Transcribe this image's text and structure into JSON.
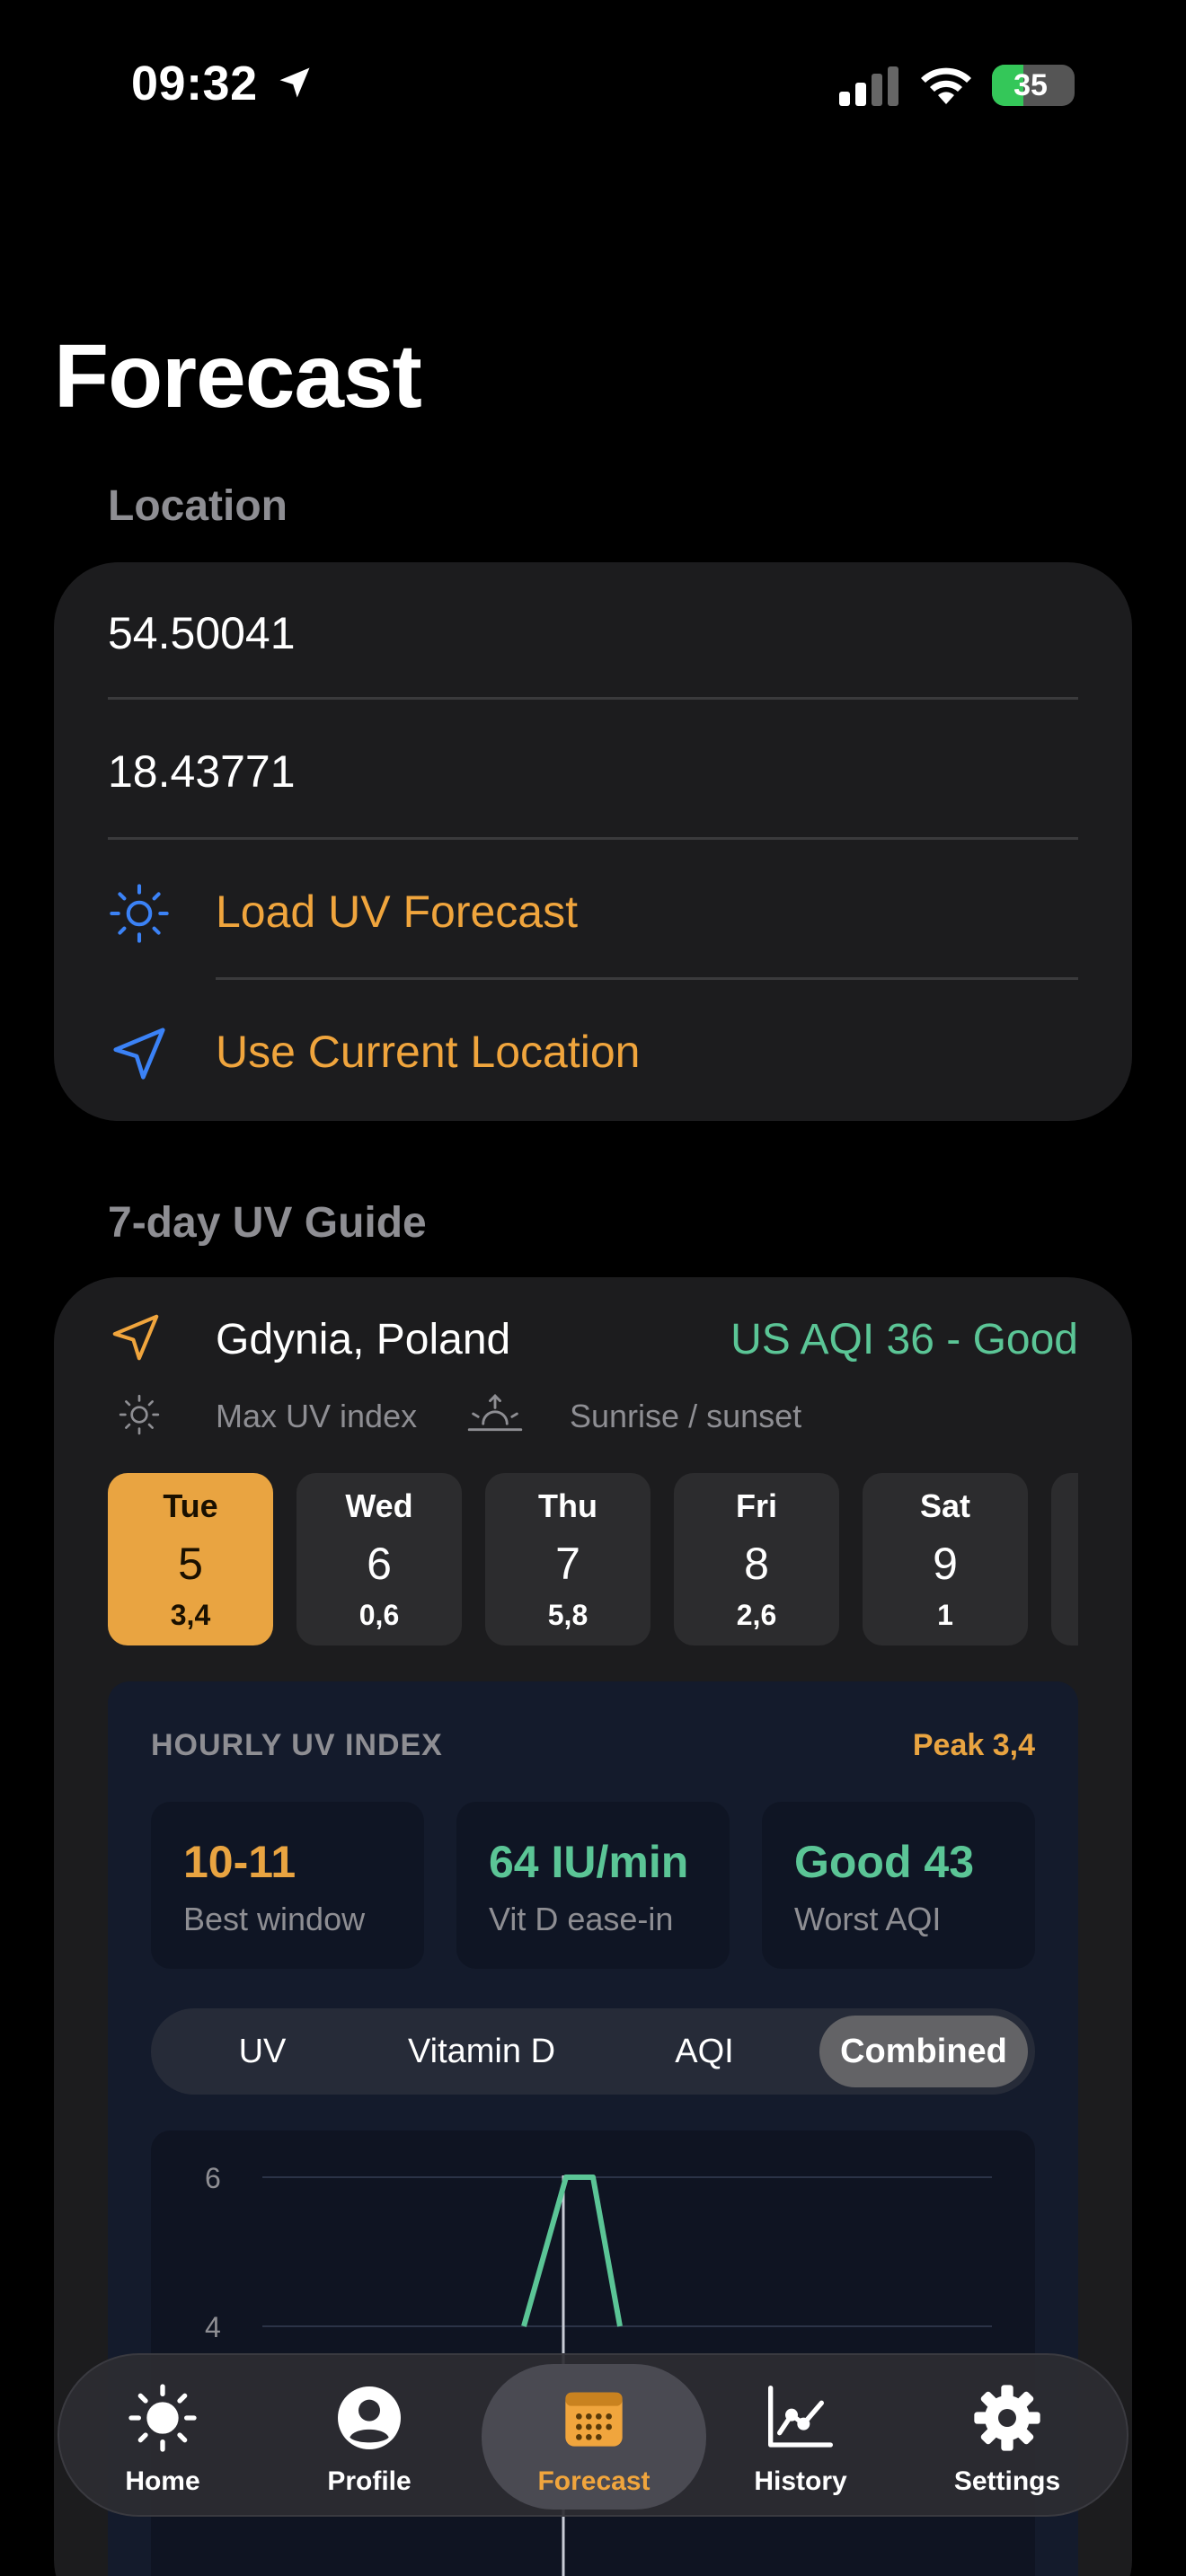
{
  "status_bar": {
    "time": "09:32",
    "battery": "35"
  },
  "title": "Forecast",
  "location_section": {
    "label": "Location",
    "latitude": "54.50041",
    "longitude": "18.43771",
    "load_action": "Load UV Forecast",
    "current_action": "Use Current Location"
  },
  "guide_section": {
    "label": "7-day UV Guide",
    "city": "Gdynia, Poland",
    "aqi": "US AQI 36 - Good",
    "legend_uv": "Max UV index",
    "legend_sun": "Sunrise / sunset",
    "days": [
      {
        "name": "Tue",
        "date": "5",
        "uv": "3,4",
        "selected": true
      },
      {
        "name": "Wed",
        "date": "6",
        "uv": "0,6"
      },
      {
        "name": "Thu",
        "date": "7",
        "uv": "5,8"
      },
      {
        "name": "Fri",
        "date": "8",
        "uv": "2,6"
      },
      {
        "name": "Sat",
        "date": "9",
        "uv": "1"
      }
    ]
  },
  "hourly": {
    "header": "HOURLY UV INDEX",
    "peak": "Peak 3,4",
    "stats": [
      {
        "value": "10-11",
        "label": "Best window",
        "color": "#e9a441"
      },
      {
        "value": "64 IU/min",
        "label": "Vit D ease-in",
        "color": "#5bc596"
      },
      {
        "value": "Good 43",
        "label": "Worst AQI",
        "color": "#5bc596"
      }
    ],
    "segments": [
      "UV",
      "Vitamin D",
      "AQI",
      "Combined"
    ],
    "active_segment": "Combined"
  },
  "chart_data": {
    "type": "line",
    "y_ticks": [
      "6",
      "4"
    ],
    "series": [
      {
        "values": [
          4,
          6,
          6,
          4
        ],
        "color": "#5bc596"
      }
    ]
  },
  "tabs": [
    {
      "label": "Home",
      "icon": "sun-icon"
    },
    {
      "label": "Profile",
      "icon": "person-icon"
    },
    {
      "label": "Forecast",
      "icon": "calendar-icon",
      "active": true
    },
    {
      "label": "History",
      "icon": "chart-line-icon"
    },
    {
      "label": "Settings",
      "icon": "gear-icon"
    }
  ],
  "colors": {
    "accent": "#f0a53d",
    "good": "#5bc596",
    "icon_blue": "#3b82f6"
  }
}
